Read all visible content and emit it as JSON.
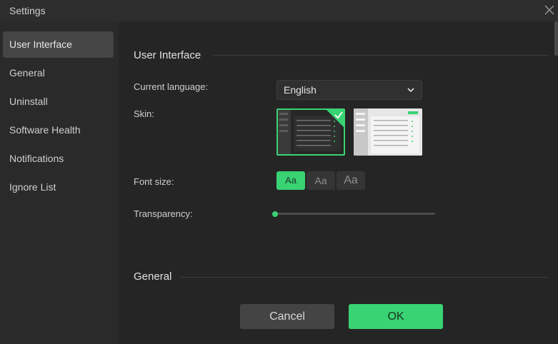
{
  "window": {
    "title": "Settings"
  },
  "sidebar": {
    "items": [
      {
        "label": "User Interface",
        "active": true
      },
      {
        "label": "General",
        "active": false
      },
      {
        "label": "Uninstall",
        "active": false
      },
      {
        "label": "Software Health",
        "active": false
      },
      {
        "label": "Notifications",
        "active": false
      },
      {
        "label": "Ignore List",
        "active": false
      }
    ]
  },
  "ui_section": {
    "title": "User Interface",
    "language_label": "Current language:",
    "language_value": "English",
    "skin_label": "Skin:",
    "skin_options": [
      "dark",
      "light"
    ],
    "skin_selected": "dark",
    "font_size_label": "Font size:",
    "font_sizes": [
      {
        "label": "Aa",
        "size": "small",
        "selected": true
      },
      {
        "label": "Aa",
        "size": "medium",
        "selected": false
      },
      {
        "label": "Aa",
        "size": "large",
        "selected": false
      }
    ],
    "transparency_label": "Transparency:",
    "transparency_value": 0
  },
  "general_section": {
    "title": "General"
  },
  "buttons": {
    "cancel": "Cancel",
    "ok": "OK"
  },
  "colors": {
    "accent": "#39d374",
    "background": "#252525",
    "sidebar": "#2a2a2a",
    "titlebar": "#2d2d2d"
  }
}
